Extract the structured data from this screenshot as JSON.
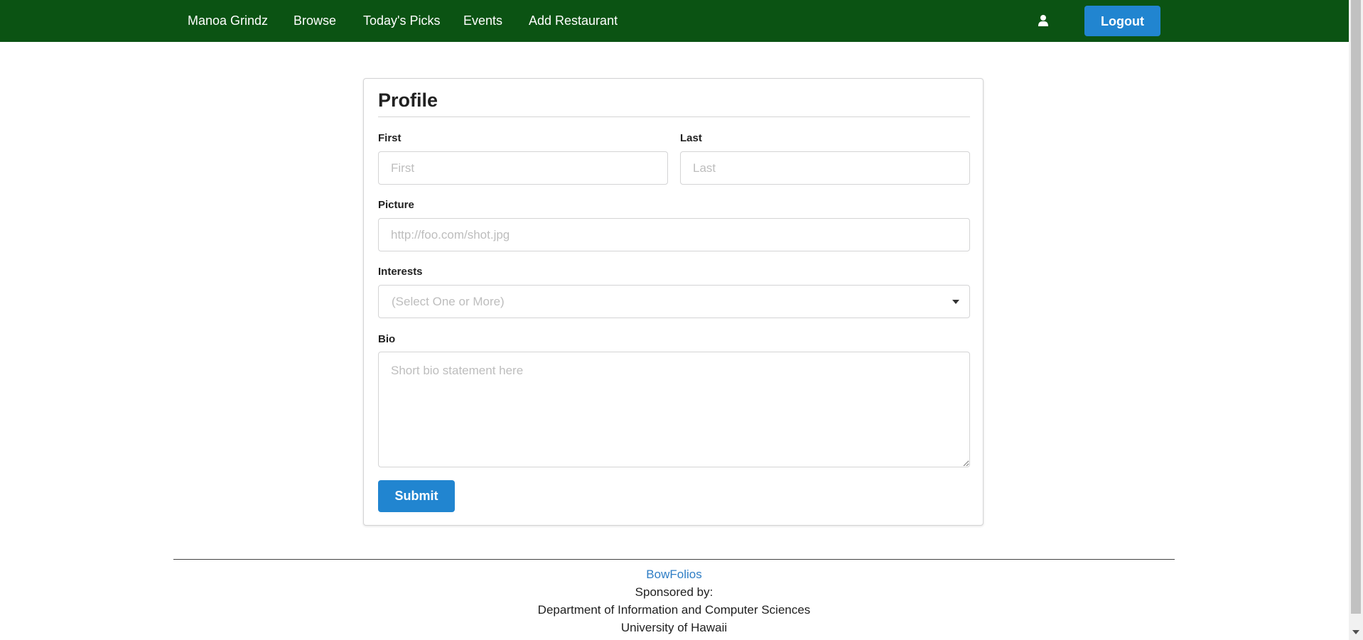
{
  "navbar": {
    "brand": "Manoa Grindz",
    "items": [
      {
        "label": "Browse"
      },
      {
        "label": "Today's Picks"
      },
      {
        "label": "Events"
      },
      {
        "label": "Add Restaurant"
      }
    ],
    "user_icon": "user-icon",
    "logout_label": "Logout",
    "background_color": "#0b5313"
  },
  "form": {
    "title": "Profile",
    "first": {
      "label": "First",
      "placeholder": "First",
      "value": ""
    },
    "last": {
      "label": "Last",
      "placeholder": "Last",
      "value": ""
    },
    "picture": {
      "label": "Picture",
      "placeholder": "http://foo.com/shot.jpg",
      "value": ""
    },
    "interests": {
      "label": "Interests",
      "placeholder": "(Select One or More)"
    },
    "bio": {
      "label": "Bio",
      "placeholder": "Short bio statement here",
      "value": ""
    },
    "submit_label": "Submit",
    "button_color": "#2185d0"
  },
  "footer": {
    "link": "BowFolios",
    "sponsored": "Sponsored by:",
    "department": "Department of Information and Computer Sciences",
    "university": "University of Hawaii"
  }
}
